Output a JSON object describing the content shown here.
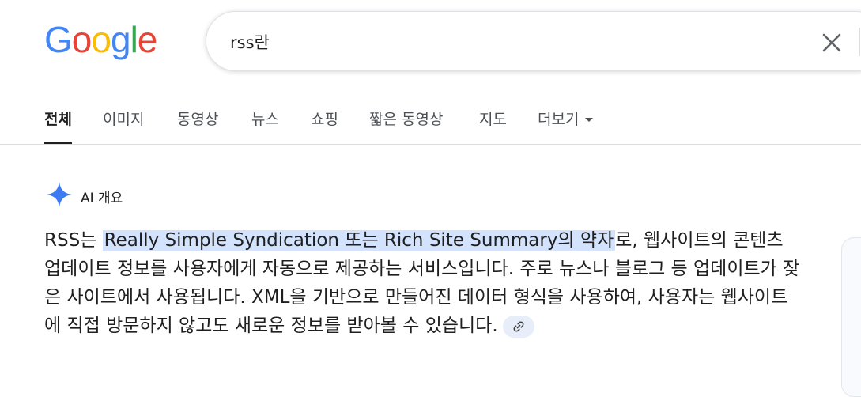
{
  "logo": {
    "letters": [
      "G",
      "o",
      "o",
      "g",
      "l",
      "e"
    ]
  },
  "search": {
    "value": "rss란",
    "placeholder": ""
  },
  "tabs": [
    {
      "label": "전체"
    },
    {
      "label": "이미지"
    },
    {
      "label": "동영상"
    },
    {
      "label": "뉴스"
    },
    {
      "label": "쇼핑"
    },
    {
      "label": "짧은 동영상"
    },
    {
      "label": "지도"
    },
    {
      "label": "더보기"
    }
  ],
  "ai_overview": {
    "label": "AI 개요",
    "answer_prefix": "RSS는 ",
    "answer_highlight": "Really Simple Syndication 또는 Rich Site Summary의 약자",
    "answer_rest": "로, 웹사이트의 콘텐츠 업데이트 정보를 사용자에게 자동으로 제공하는 서비스입니다. 주로 뉴스나 블로그 등 업데이트가 잦은 사이트에서 사용됩니다. XML을 기반으로 만들어진 데이터 형식을 사용하여, 사용자는 웹사이트에 직접 방문하지 않고도 새로운 정보를 받아볼 수 있습니다."
  },
  "colors": {
    "blue": "#4285f4",
    "red": "#ea4335",
    "yellow": "#fbbc05",
    "green": "#34a853",
    "highlight": "#d3e3fd"
  },
  "icons": {
    "clear": "close-icon",
    "ai": "sparkle-icon",
    "link": "link-icon",
    "more": "caret-down-icon"
  }
}
